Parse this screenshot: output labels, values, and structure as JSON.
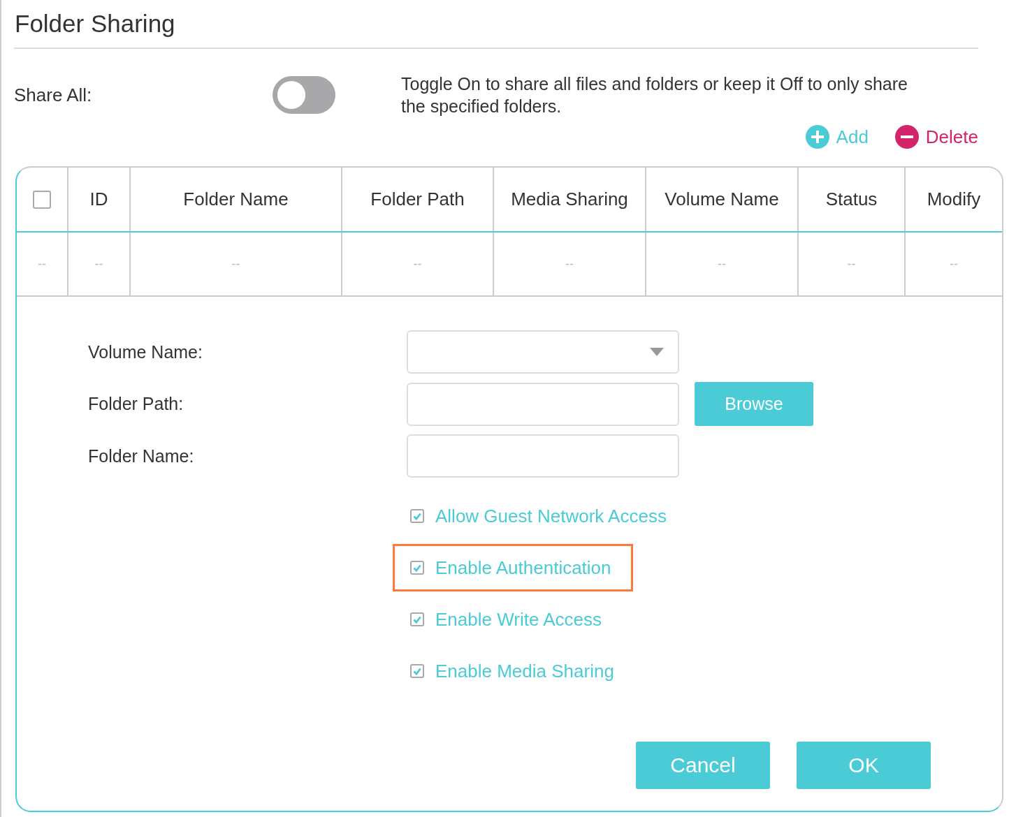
{
  "title": "Folder Sharing",
  "share_all": {
    "label": "Share All:",
    "on": false,
    "description": "Toggle On to share all files and folders or keep it Off to only share the specified folders."
  },
  "actions": [
    {
      "kind": "add",
      "label": "Add"
    },
    {
      "kind": "delete",
      "label": "Delete"
    }
  ],
  "table": {
    "select_all_checked": false,
    "columns": [
      "",
      "ID",
      "Folder Name",
      "Folder Path",
      "Media Sharing",
      "Volume Name",
      "Status",
      "Modify"
    ],
    "rows": [
      {
        "cells": [
          "--",
          "--",
          "--",
          "--",
          "--",
          "--",
          "--",
          "--"
        ]
      }
    ]
  },
  "form": {
    "fields": [
      {
        "kind": "dropdown",
        "label": "Volume Name:"
      },
      {
        "kind": "text",
        "label": "Folder Path:",
        "button": "Browse"
      },
      {
        "kind": "text",
        "label": "Folder Name:"
      }
    ],
    "options": [
      {
        "label": "Allow Guest Network Access",
        "checked": true,
        "highlighted": false
      },
      {
        "label": "Enable Authentication",
        "checked": true,
        "highlighted": true
      },
      {
        "label": "Enable Write Access",
        "checked": true,
        "highlighted": false
      },
      {
        "label": "Enable Media Sharing",
        "checked": true,
        "highlighted": false
      }
    ],
    "buttons": [
      "Cancel",
      "OK"
    ]
  }
}
